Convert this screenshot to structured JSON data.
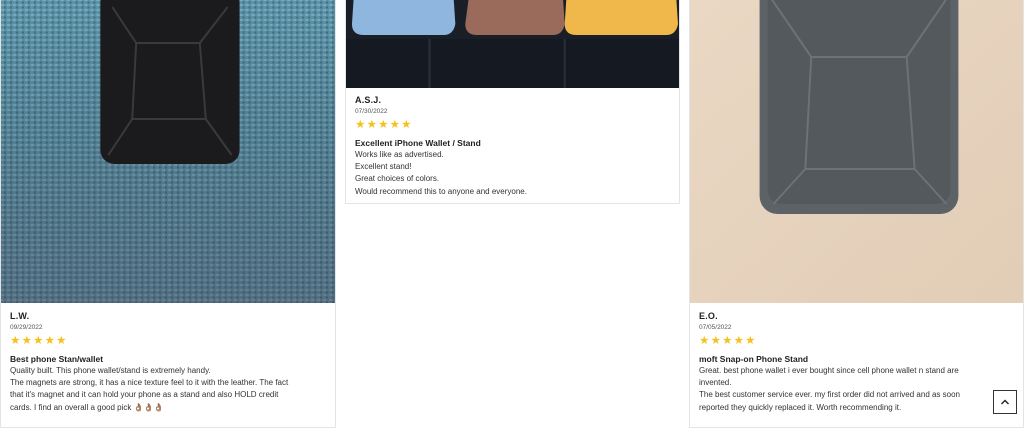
{
  "reviews": [
    {
      "author": "L.W.",
      "date": "09/29/2022",
      "rating": 5,
      "title": "Best phone Stan/wallet",
      "lines": [
        "Quality built. This phone wallet/stand is extremely handy.",
        "The magnets are strong, it has a nice texture feel to it with the leather. The fact",
        "that it's magnet and it can hold your phone as a stand and also HOLD credit",
        "cards. I find an overall a good pick 👌🏽👌🏽👌🏽"
      ]
    },
    {
      "author": "A.S.J.",
      "date": "07/30/2022",
      "rating": 5,
      "title": "Excellent iPhone Wallet / Stand",
      "lines": [
        "Works like as advertised.",
        "Excellent stand!",
        "Great choices of colors.",
        "Would recommend this to anyone and everyone."
      ]
    },
    {
      "author": "E.O.",
      "date": "07/05/2022",
      "rating": 5,
      "title": "moft Snap-on Phone Stand",
      "lines": [
        "Great. best phone wallet i ever bought since cell phone wallet n stand are",
        "invented.",
        "The best customer service ever. my first order did not arrived and as soon",
        "reported they quickly replaced it. Worth recommending it."
      ]
    }
  ],
  "colors": {
    "star": "#f3c21c",
    "border": "#e4e4e4"
  },
  "icons": {
    "star": "star-icon",
    "back_to_top": "chevron-up-icon"
  }
}
